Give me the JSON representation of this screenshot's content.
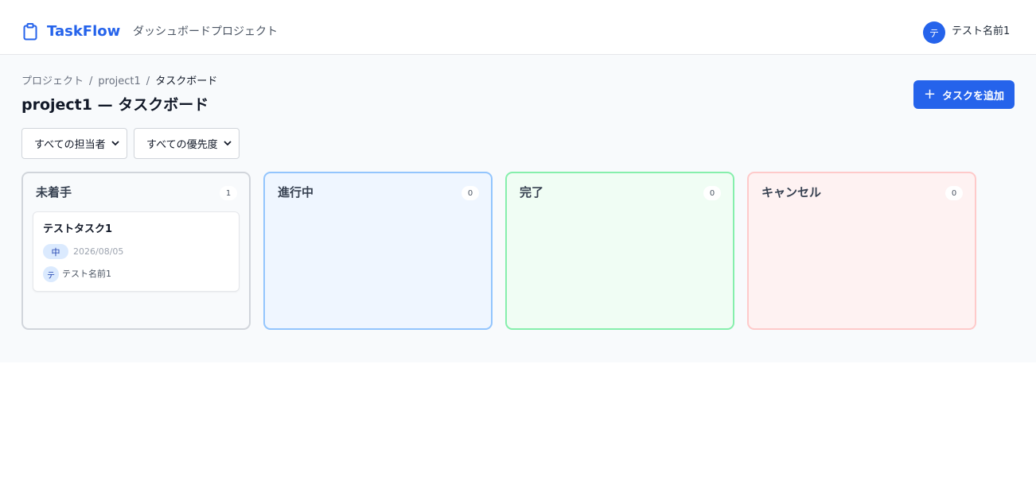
{
  "nav": {
    "brand": "TaskFlow",
    "links": [
      {
        "label": "ダッシュボード"
      },
      {
        "label": "プロジェクト"
      }
    ],
    "user": {
      "initial": "テ",
      "name": "テスト名前1"
    }
  },
  "breadcrumb": {
    "items": [
      "プロジェクト",
      "project1",
      "タスクボード"
    ],
    "separator": "/"
  },
  "page": {
    "title": "project1 — タスクボード",
    "add_button": "タスクを追加"
  },
  "filters": {
    "assignee": "すべての担当者",
    "priority": "すべての優先度"
  },
  "columns": [
    {
      "title": "未着手",
      "count": "1"
    },
    {
      "title": "進行中",
      "count": "0"
    },
    {
      "title": "完了",
      "count": "0"
    },
    {
      "title": "キャンセル",
      "count": "0"
    }
  ],
  "tasks": [
    {
      "title": "テストタスク1",
      "priority": "中",
      "due_date": "2026/08/05",
      "assignee_initial": "テ",
      "assignee": "テスト名前1"
    }
  ],
  "colors": {
    "primary": "#2563eb",
    "todo_border": "#d1d5db",
    "progress_border": "#93c5fd",
    "done_border": "#86efac",
    "cancel_border": "#fecaca"
  },
  "icons": {
    "logo": "clipboard-icon",
    "add": "plus-icon",
    "select": "chevron-down-icon"
  }
}
